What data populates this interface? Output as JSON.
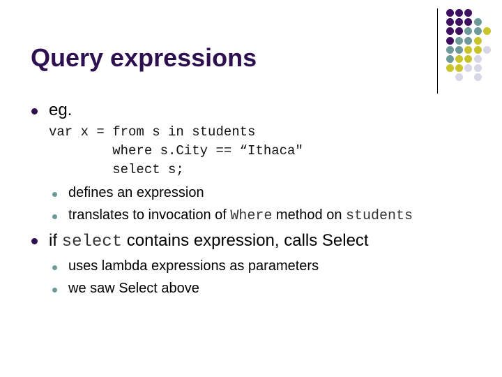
{
  "slide": {
    "title": "Query expressions",
    "colors": {
      "title": "#2e0f4f",
      "purple": "#3d0f5e",
      "teal": "#6f9a9a",
      "yellow": "#c9c42a",
      "lavender": "#d6d6e6"
    },
    "bullets": [
      {
        "level": 1,
        "text": "eg.",
        "code_lines": [
          "var x = from s in students",
          "        where s.City == “Ithaca\"",
          "        select s;"
        ]
      },
      {
        "level": 2,
        "text": "defines an expression"
      },
      {
        "level": 2,
        "parts": [
          "translates to invocation of ",
          "Where",
          " method on ",
          "students"
        ]
      },
      {
        "level": 1,
        "parts": [
          "if ",
          "select",
          " contains expression, calls Select"
        ]
      },
      {
        "level": 2,
        "text": "uses lambda expressions as parameters"
      },
      {
        "level": 2,
        "text": "we saw Select above"
      }
    ]
  },
  "decoration": {
    "dot_grid": [
      [
        "purple",
        "purple",
        "purple",
        null,
        null
      ],
      [
        "purple",
        "purple",
        "purple",
        "teal",
        null
      ],
      [
        "purple",
        "purple",
        "teal",
        "teal",
        "yellow"
      ],
      [
        "purple",
        "teal",
        "teal",
        "yellow",
        null
      ],
      [
        "teal",
        "teal",
        "yellow",
        "yellow",
        "lavender"
      ],
      [
        "teal",
        "yellow",
        "yellow",
        "lavender",
        null
      ],
      [
        "yellow",
        "yellow",
        "lavender",
        "lavender",
        null
      ],
      [
        null,
        "lavender",
        null,
        "lavender",
        null
      ]
    ]
  }
}
